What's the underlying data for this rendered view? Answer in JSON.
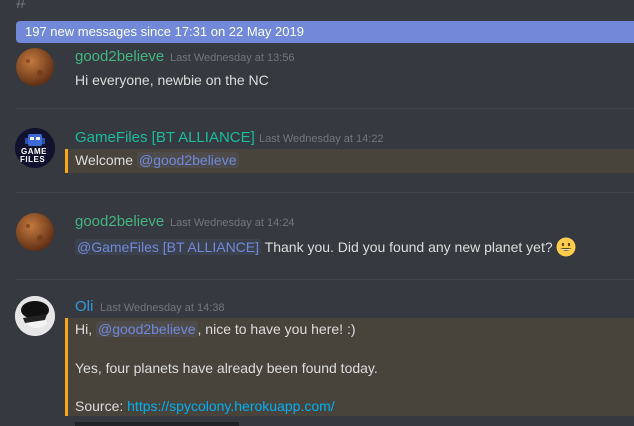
{
  "banner": {
    "text": "197 new messages since 17:31 on 22 May 2019"
  },
  "messages": [
    {
      "user": "good2believe",
      "user_color": "#43b581",
      "time": "Last Wednesday at 13:56",
      "text": "Hi everyone, newbie on the NC"
    },
    {
      "user": "GameFiles [BT ALLIANCE]",
      "user_color": "#1abc9c",
      "time": "Last Wednesday at 14:22",
      "text_pre": "Welcome ",
      "mention": "@good2believe"
    },
    {
      "user": "good2believe",
      "user_color": "#43b581",
      "time": "Last Wednesday at 14:24",
      "mention": "@GameFiles [BT ALLIANCE]",
      "text_post": " Thank you. Did you found any new planet yet?",
      "emoji": "grinning-face-emoji"
    },
    {
      "user": "Oli",
      "user_color": "#3498db",
      "time": "Last Wednesday at 14:38",
      "line1_pre": "Hi, ",
      "mention": "@good2believe",
      "line1_post": ", nice to have you here! :)",
      "line2": "Yes, four planets have already been found today.",
      "line3_label": "Source: ",
      "link": "https://spycolony.herokuapp.com/"
    }
  ],
  "avatar_texts": {
    "gamefiles_logo_line1": "GAME",
    "gamefiles_logo_line2": "FILES"
  },
  "colors": {
    "background": "#36393f",
    "banner": "#7289da",
    "mention_text": "#7289da",
    "highlight_border": "#faa61a",
    "timestamp": "#72767d",
    "link": "#00b0f4"
  }
}
